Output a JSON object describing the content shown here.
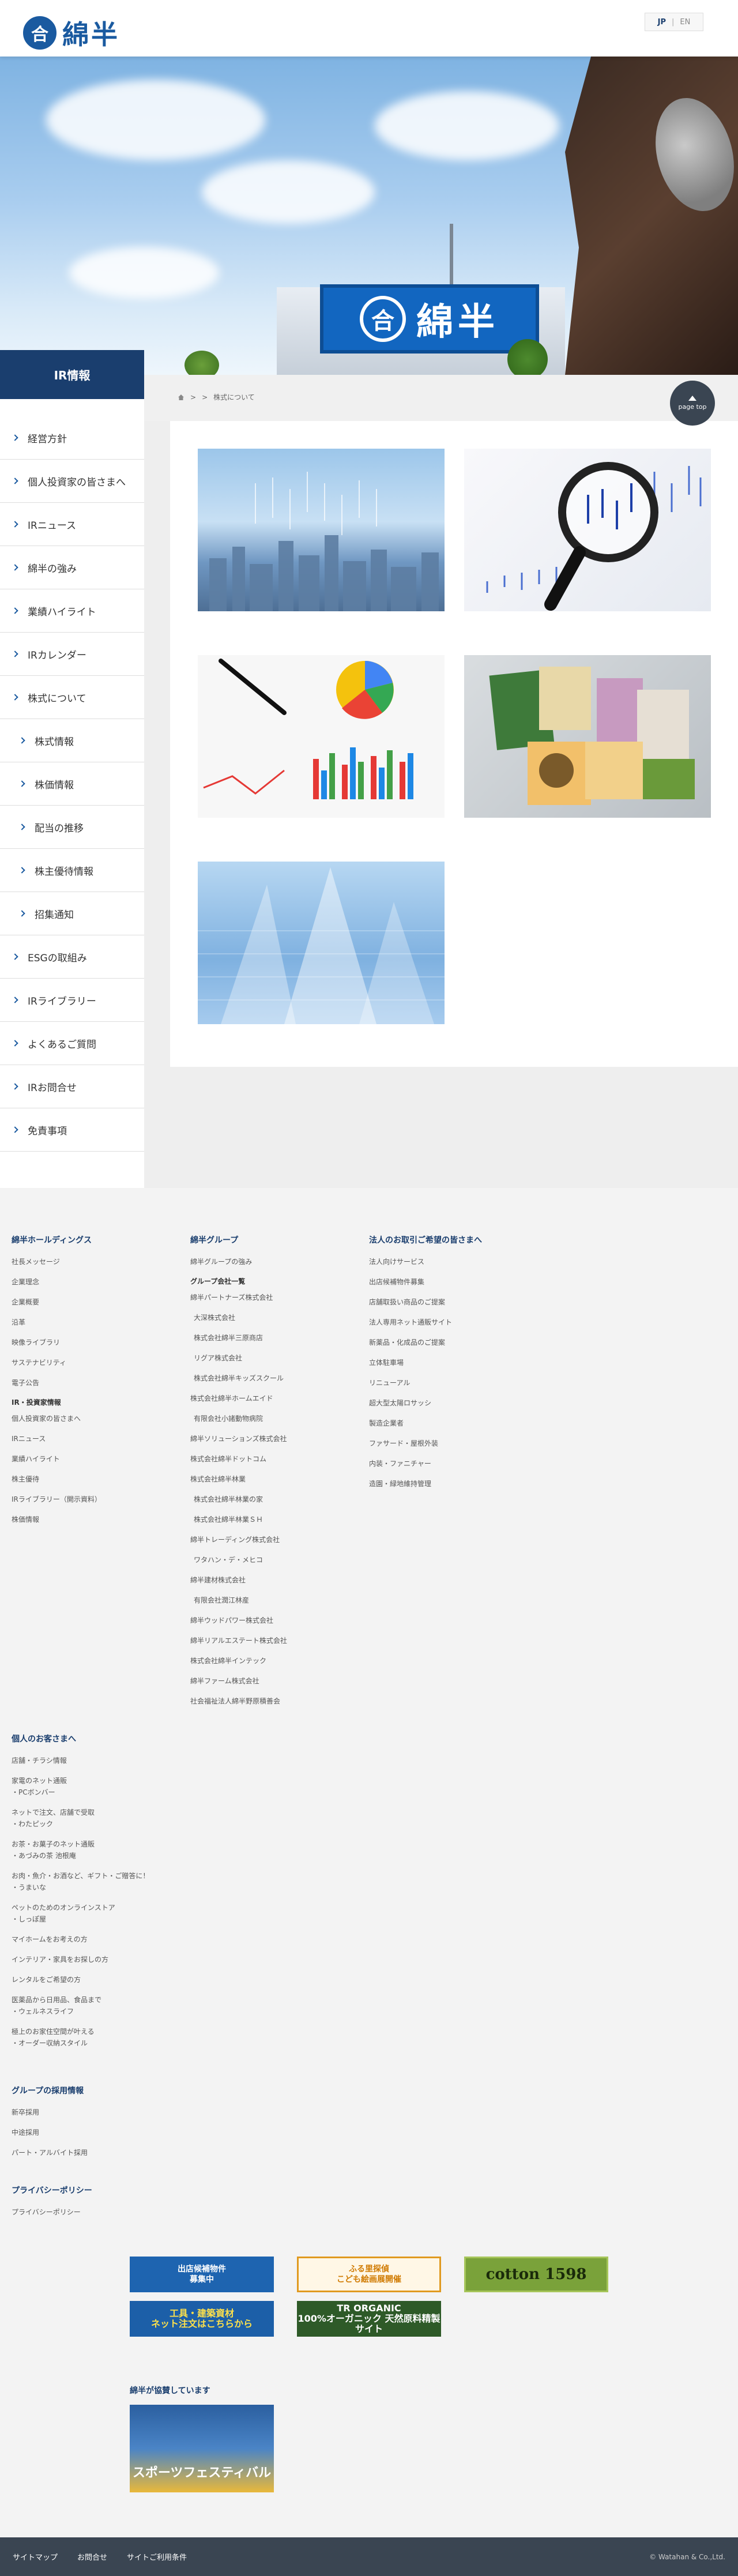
{
  "header": {
    "logo_mark": "合",
    "logo_text": "綿半",
    "lang_jp": "JP",
    "lang_sep": "|",
    "lang_en": "EN"
  },
  "hero": {
    "sign_mark": "合",
    "sign_text": "綿半"
  },
  "section_label": "IR情報",
  "breadcrumb": {
    "sep1": ">",
    "sep2": ">",
    "current": "株式について"
  },
  "page_top": "page top",
  "sidebar": [
    {
      "label": "経営方針",
      "sub": false
    },
    {
      "label": "個人投資家の皆さまへ",
      "sub": false
    },
    {
      "label": "IRニュース",
      "sub": false
    },
    {
      "label": "綿半の強み",
      "sub": false
    },
    {
      "label": "業績ハイライト",
      "sub": false
    },
    {
      "label": "IRカレンダー",
      "sub": false
    },
    {
      "label": "株式について",
      "sub": false
    },
    {
      "label": "株式情報",
      "sub": true
    },
    {
      "label": "株価情報",
      "sub": true
    },
    {
      "label": "配当の推移",
      "sub": true
    },
    {
      "label": "株主優待情報",
      "sub": true
    },
    {
      "label": "招集通知",
      "sub": true
    },
    {
      "label": "ESGの取組み",
      "sub": false
    },
    {
      "label": "IRライブラリー",
      "sub": false
    },
    {
      "label": "よくあるご質問",
      "sub": false
    },
    {
      "label": "IRお問合せ",
      "sub": false
    },
    {
      "label": "免責事項",
      "sub": false
    }
  ],
  "footer": {
    "col1": {
      "head": "綿半ホールディングス",
      "links": [
        "社長メッセージ",
        "企業理念",
        "企業概要",
        "沿革",
        "映像ライブラリ",
        "サステナビリティ",
        "電子公告"
      ],
      "sub": "IR・投資家情報",
      "sub_links": [
        "個人投資家の皆さまへ",
        "IRニュース",
        "業績ハイライト",
        "株主優待",
        "IRライブラリー（開示資料）",
        "株価情報"
      ]
    },
    "col2": {
      "head": "綿半グループ",
      "links": [
        "綿半グループの強み"
      ],
      "sub": "グループ会社一覧",
      "sub_links": [
        "綿半パートナーズ株式会社",
        " 大深株式会社",
        " 株式会社綿半三原商店",
        " リグア株式会社",
        " 株式会社綿半キッズスクール",
        "株式会社綿半ホームエイド",
        " 有限会社小諸動物病院",
        "綿半ソリューションズ株式会社",
        "株式会社綿半ドットコム",
        "株式会社綿半林業",
        " 株式会社綿半林業の家",
        " 株式会社綿半林業ＳＨ",
        "綿半トレーディング株式会社",
        " ワタハン・デ・メヒコ",
        "綿半建材株式会社",
        " 有限会社潤江林産",
        "綿半ウッドパワー株式会社",
        "綿半リアルエステート株式会社",
        "株式会社綿半インテック",
        "綿半ファーム株式会社",
        "社会福祉法人綿半野原積善会"
      ]
    },
    "col3": {
      "head": "法人のお取引ご希望の皆さまへ",
      "links": [
        "法人向けサービス",
        "出店候補物件募集",
        "店舗取扱い商品のご提案",
        "法人専用ネット通販サイト",
        "新薬品・化成品のご提案",
        "立体駐車場",
        "リニューアル",
        "超大型太陽ロサッシ",
        "製造企業者",
        "ファサード・屋根外装",
        "内装・ファニチャー",
        "造園・緑地維持管理"
      ]
    },
    "col4": {
      "head": "個人のお客さまへ",
      "links": [
        "店舗・チラシ情報",
        "家電のネット通販\n・PCボンバー",
        "ネットで注文、店舗で受取\n・わたピック",
        "お茶・お菓子のネット通販\n・あづみの茶 池根庵",
        "お肉・魚介・お酒など、ギフト・ご贈答に！\n・うまいな",
        "ペットのためのオンラインストア\n・しっぽ屋",
        "マイホームをお考えの方",
        "インテリア・家具をお探しの方",
        "レンタルをご希望の方",
        "医薬品から日用品、食品まで\n・ウェルネスライフ",
        "極上のお家住空間が叶える\n・オーダー収納スタイル"
      ]
    },
    "col5": {
      "head": "グループの採用情報",
      "links": [
        "新卒採用",
        "中途採用",
        "パート・アルバイト採用"
      ]
    },
    "col6": {
      "head": "プライバシーポリシー",
      "links": [
        "プライバシーポリシー"
      ]
    },
    "banners": {
      "b1": "出店候補物件\n募集中",
      "b2": "ふる里探偵\nこども絵画展開催",
      "b3": "cotton 1598",
      "b4": "工具・建築資材\nネット注文はこちらから",
      "b5": "TR ORGANIC\n100%オーガニック 天然原料精製サイト"
    },
    "support_head": "綿半が協賛しています",
    "support_img_text": "スポーツフェスティバル"
  },
  "bottom": {
    "links": [
      "サイトマップ",
      "お問合せ",
      "サイトご利用条件"
    ],
    "copyright": "© Watahan & Co.,Ltd."
  }
}
